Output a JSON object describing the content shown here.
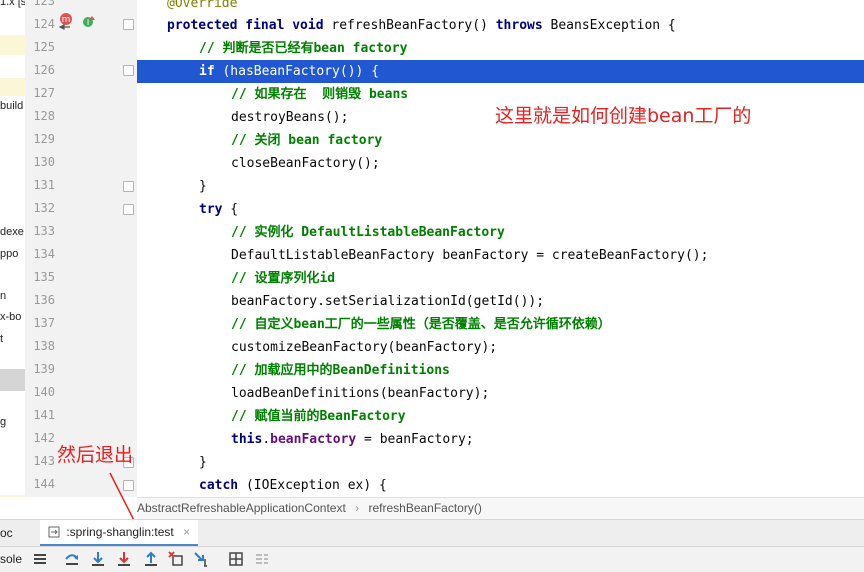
{
  "left_panel": {
    "fragments": [
      "1.x [s",
      "build",
      "dexe",
      "ppo",
      "n",
      "x-bo",
      "t",
      "g"
    ]
  },
  "gutter": {
    "line_numbers": [
      "123",
      "124",
      "125",
      "126",
      "127",
      "128",
      "129",
      "130",
      "131",
      "132",
      "133",
      "134",
      "135",
      "136",
      "137",
      "138",
      "139",
      "140",
      "141",
      "142",
      "143",
      "144"
    ],
    "badge_m": "m",
    "badge_i": "I"
  },
  "code": {
    "l0": "@Override",
    "l1_kw": "protected final void",
    "l1_rest": " refreshBeanFactory() ",
    "l1_kw2": "throws",
    "l1_rest2": " BeansException {",
    "l2": "// 判断是否已经有bean factory",
    "l3_kw": "if",
    "l3_rest": " (hasBeanFactory()) {",
    "l4": "// 如果存在  则销毁 beans",
    "l5": "destroyBeans();",
    "l6": "// 关闭 bean factory",
    "l7": "closeBeanFactory();",
    "l8": "}",
    "l9_kw": "try",
    "l9_rest": " {",
    "l10": "// 实例化 DefaultListableBeanFactory",
    "l11": "DefaultListableBeanFactory beanFactory = createBeanFactory();",
    "l12": "// 设置序列化id",
    "l13": "beanFactory.setSerializationId(getId());",
    "l14": "// 自定义bean工厂的一些属性（是否覆盖、是否允许循环依赖）",
    "l15": "customizeBeanFactory(beanFactory);",
    "l16": "// 加载应用中的BeanDefinitions",
    "l17": "loadBeanDefinitions(beanFactory);",
    "l18": "// 赋值当前的BeanFactory",
    "l19_kw": "this",
    "l19_dot": ".",
    "l19_fld": "beanFactory",
    "l19_rest": " = beanFactory;",
    "l20": "}",
    "l21_kw": "catch",
    "l21_rest": " (IOException ex) {"
  },
  "annotations": {
    "note1": "这里就是如何创建bean工厂的",
    "note2": "然后退出"
  },
  "breadcrumb": {
    "class_name": "AbstractRefreshableApplicationContext",
    "separator": "›",
    "method_name": "refreshBeanFactory()"
  },
  "tabs": {
    "left_fragment": "oc",
    "active_tab": ":spring-shanglin:test",
    "close": "×"
  },
  "toolbar": {
    "console_label": "sole"
  },
  "colors": {
    "current_line": "#2157d1",
    "keyword": "#000080",
    "comment": "#008000",
    "annotation_red": "#e8211f"
  }
}
